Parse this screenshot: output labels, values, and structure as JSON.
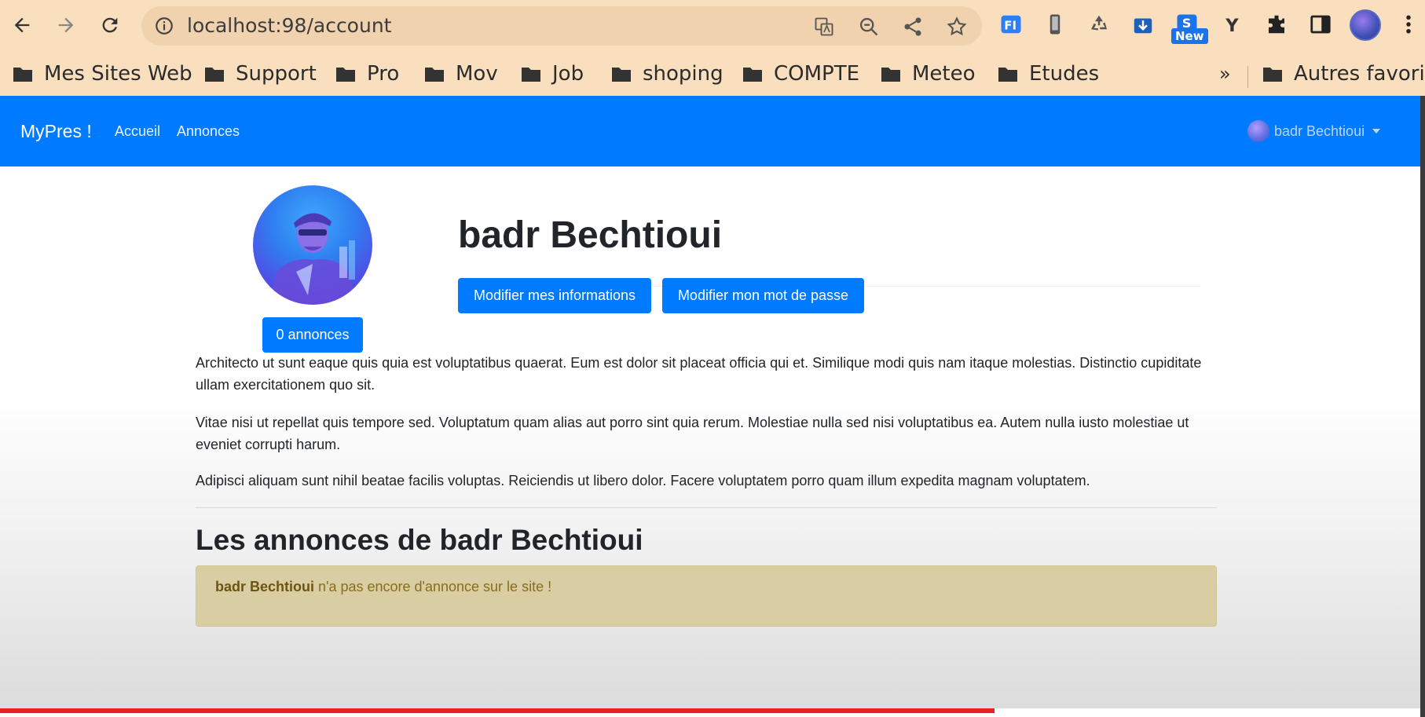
{
  "browser": {
    "url": "localhost:98/account",
    "new_badge": "New",
    "bookmarks": [
      {
        "label": "Mes Sites Web"
      },
      {
        "label": "Support"
      },
      {
        "label": "Pro"
      },
      {
        "label": "Mov"
      },
      {
        "label": "Job"
      },
      {
        "label": "shoping"
      },
      {
        "label": "COMPTE"
      },
      {
        "label": "Meteo"
      },
      {
        "label": "Etudes"
      }
    ],
    "more_bookmarks": "»",
    "other_bookmarks": "Autres favoris"
  },
  "navbar": {
    "brand": "MyPres !",
    "links": [
      "Accueil",
      "Annonces"
    ],
    "user_name": "badr Bechtioui",
    "color": "#007bff"
  },
  "profile": {
    "name": "badr Bechtioui",
    "ads_count_label": "0 annonces",
    "edit_info_label": "Modifier mes informations",
    "edit_password_label": "Modifier mon mot de passe"
  },
  "bio": [
    "Architecto ut sunt eaque quis quia est voluptatibus quaerat. Eum est dolor sit placeat officia qui et. Similique modi quis nam itaque molestias. Distinctio cupiditate ullam exercitationem quo sit.",
    "Vitae nisi ut repellat quis tempore sed. Voluptatum quam alias aut porro sint quia rerum. Molestiae nulla sed nisi voluptatibus ea. Autem nulla iusto molestiae ut eveniet corrupti harum.",
    "Adipisci aliquam sunt nihil beatae facilis voluptas. Reiciendis ut libero dolor. Facere voluptatem porro quam illum expedita magnam voluptatem."
  ],
  "ads_section": {
    "title": "Les annonces de badr Bechtioui",
    "empty_name": "badr Bechtioui",
    "empty_message": " n'a pas encore d'annonce sur le site !"
  },
  "video": {
    "progress_fraction": 0.7
  }
}
